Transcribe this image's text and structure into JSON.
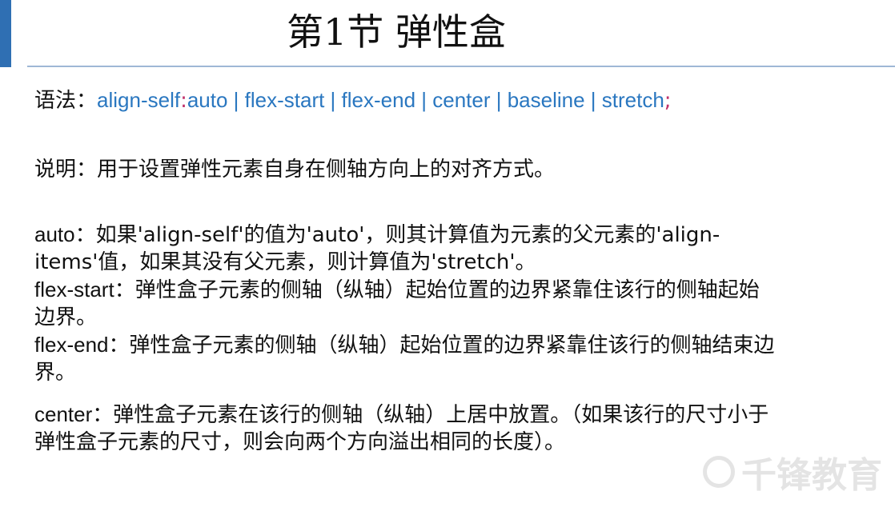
{
  "title": "第1节 弹性盒",
  "syntax": {
    "label": "语法：",
    "code_part1": "align-self",
    "colon": ":",
    "code_part2": "auto | flex-start | flex-end | center | baseline | stretch",
    "semicolon": ";"
  },
  "description": {
    "label": "说明：",
    "text": "用于设置弹性元素自身在侧轴方向上的对齐方式。"
  },
  "items": [
    {
      "term": "auto",
      "text": "：如果'align-self'的值为'auto'，则其计算值为元素的父元素的'align-items'值，如果其没有父元素，则计算值为'stretch'。"
    },
    {
      "term": "flex-start",
      "text": "：弹性盒子元素的侧轴（纵轴）起始位置的边界紧靠住该行的侧轴起始边界。"
    },
    {
      "term": "flex-end",
      "text": "：弹性盒子元素的侧轴（纵轴）起始位置的边界紧靠住该行的侧轴结束边界。"
    },
    {
      "term": "center",
      "text": "：弹性盒子元素在该行的侧轴（纵轴）上居中放置。（如果该行的尺寸小于弹性盒子元素的尺寸，则会向两个方向溢出相同的长度）。"
    }
  ],
  "watermark": {
    "text": "千锋教育",
    "icon": "brand-circle-icon"
  },
  "colors": {
    "accent": "#2f6fb3",
    "code": "#2a77c0",
    "separator": "#c0306a",
    "rule": "#9fb7d6"
  }
}
